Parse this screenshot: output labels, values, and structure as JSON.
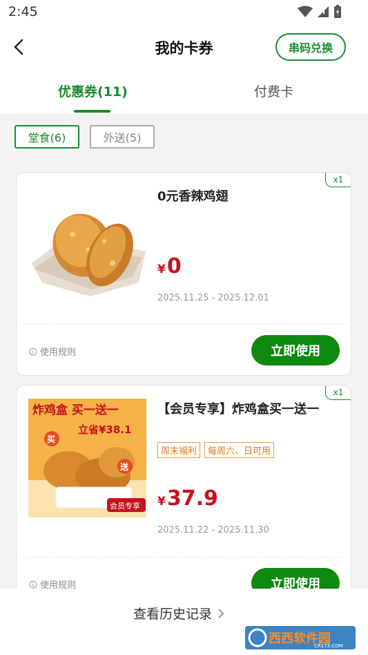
{
  "status_bar": {
    "time": "2:45"
  },
  "header": {
    "title": "我的卡券",
    "redeem_label": "串码兑换"
  },
  "tabs": [
    {
      "label": "优惠券(11)",
      "active": true
    },
    {
      "label": "付费卡",
      "active": false
    }
  ],
  "filters": [
    {
      "label": "堂食(6)",
      "active": true
    },
    {
      "label": "外送(5)",
      "active": false
    }
  ],
  "coupons": [
    {
      "quantity": "x1",
      "title": "0元香辣鸡翅",
      "tags": [],
      "currency": "¥",
      "price": "0",
      "dates": "2025.11.25 - 2025.12.01",
      "rules_label": "使用规则",
      "use_label": "立即使用"
    },
    {
      "quantity": "x1",
      "title": "【会员专享】炸鸡盒买一送一",
      "tags": [
        "周末福利",
        "每周六、日可用"
      ],
      "currency": "¥",
      "price": "37.9",
      "dates": "2025.11.22 - 2025.11.30",
      "rules_label": "使用规则",
      "use_label": "立即使用",
      "image_text": {
        "headline": "炸鸡盒 买一送一",
        "save": "立省¥38.1",
        "buy": "买",
        "give": "送",
        "member": "会员专享"
      }
    }
  ],
  "footer": {
    "history_label": "查看历史记录"
  },
  "watermark": {
    "text": "西西软件园",
    "sub": "CR173.COM"
  },
  "colors": {
    "brand_green": "#1a8a2c",
    "price_red": "#c8111f",
    "tag_orange": "#e07820"
  }
}
